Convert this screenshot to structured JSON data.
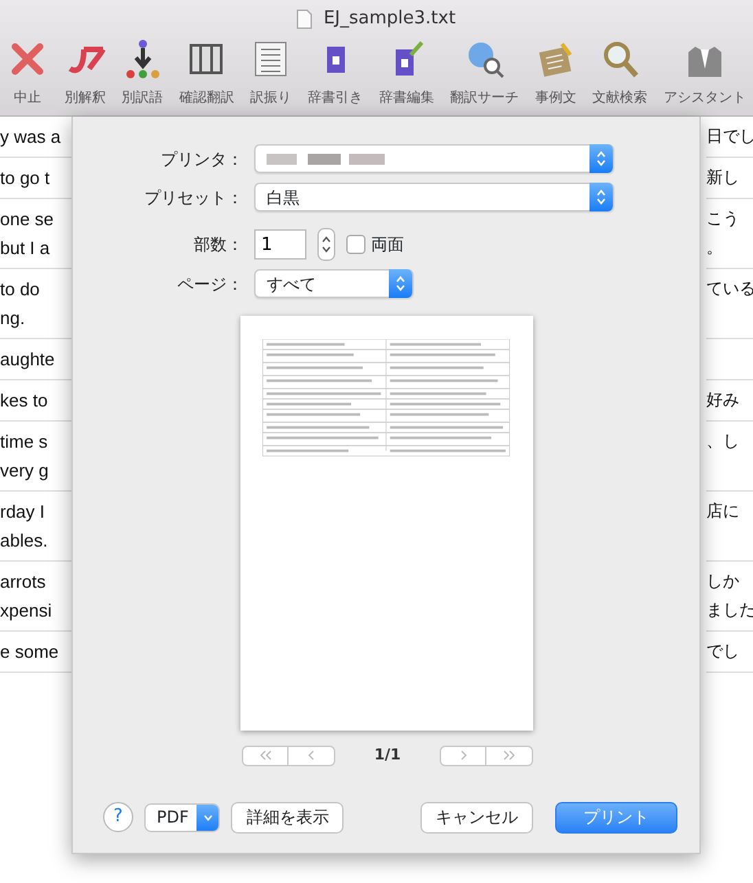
{
  "window": {
    "title": "EJ_sample3.txt"
  },
  "toolbar": [
    {
      "label": "中止",
      "kind": "stop"
    },
    {
      "label": "別解釈",
      "kind": "alt"
    },
    {
      "label": "別訳語",
      "kind": "www"
    },
    {
      "label": "確認翻訳",
      "kind": "columns"
    },
    {
      "label": "訳振り",
      "kind": "lines"
    },
    {
      "label": "辞書引き",
      "kind": "dict"
    },
    {
      "label": "辞書編集",
      "kind": "dictedit"
    },
    {
      "label": "翻訳サーチ",
      "kind": "globe"
    },
    {
      "label": "事例文",
      "kind": "notebook"
    },
    {
      "label": "文献検索",
      "kind": "magnifier"
    },
    {
      "label": "アシスタント",
      "kind": "suit"
    }
  ],
  "document_rows": [
    {
      "left": [
        "y was a"
      ],
      "right": [
        "日でし"
      ]
    },
    {
      "left": [
        "to go t"
      ],
      "right": [
        "新し"
      ]
    },
    {
      "left": [
        "one se",
        "but I a"
      ],
      "right": [
        "こう",
        "。"
      ]
    },
    {
      "left": [
        "to do",
        "ng."
      ],
      "right": [
        "ている"
      ]
    },
    {
      "left": [
        "aughte"
      ],
      "right": []
    },
    {
      "left": [
        "kes to"
      ],
      "right": [
        "好み"
      ]
    },
    {
      "left": [
        "time s",
        "very g"
      ],
      "right": [
        "、し"
      ]
    },
    {
      "left": [
        "rday I",
        "ables."
      ],
      "right": [
        "店に"
      ]
    },
    {
      "left": [
        "arrots",
        "xpensi"
      ],
      "right": [
        "しか",
        "ました"
      ]
    },
    {
      "left": [
        "e some"
      ],
      "right": [
        "でし"
      ]
    }
  ],
  "print_dialog": {
    "printer": {
      "label": "プリンタ："
    },
    "preset": {
      "label": "プリセット：",
      "value": "白黒"
    },
    "copies": {
      "label": "部数：",
      "value": "1"
    },
    "two_sided": {
      "label": "両面",
      "checked": false
    },
    "pages": {
      "label": "ページ：",
      "value": "すべて"
    },
    "page_indicator": "1/1",
    "help": "?",
    "pdf": "PDF",
    "buttons": [
      {
        "label": "詳細を表示",
        "kind": "default"
      },
      {
        "label": "キャンセル",
        "kind": "default"
      },
      {
        "label": "プリント",
        "kind": "primary"
      }
    ]
  }
}
